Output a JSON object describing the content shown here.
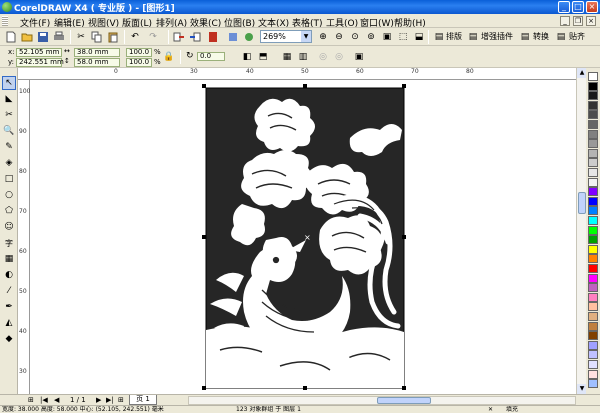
{
  "window": {
    "title": "CorelDRAW X4 ( 专业版 ) - [图形1]"
  },
  "menu": [
    "文件(F)",
    "编辑(E)",
    "视图(V)",
    "版面(L)",
    "排列(A)",
    "效果(C)",
    "位图(B)",
    "文本(X)",
    "表格(T)",
    "工具(O)",
    "窗口(W)",
    "帮助(H)"
  ],
  "toolbar": {
    "zoom_level": "269%",
    "buttons": {
      "layout": "排版",
      "plugins": "增强插件",
      "convert": "转换",
      "paste": "贴齐"
    }
  },
  "property_bar": {
    "x_label": "x:",
    "x_value": "52.105 mm",
    "y_label": "y:",
    "y_value": "242.551 mm",
    "width_value": "38.0 mm",
    "height_value": "58.0 mm",
    "scale_x": "100.0",
    "scale_y": "100.0",
    "percent": "%",
    "rotation": "0.0"
  },
  "ruler": {
    "h_labels": [
      "0",
      "30",
      "40",
      "50",
      "60",
      "70",
      "80"
    ],
    "v_labels": [
      "100",
      "90",
      "80",
      "70",
      "60",
      "50",
      "40",
      "30"
    ]
  },
  "palette_colors": [
    "#ffffff",
    "#000000",
    "#1a1a1a",
    "#333333",
    "#4d4d4d",
    "#666666",
    "#808080",
    "#999999",
    "#b3b3b3",
    "#cccccc",
    "#e6e6e6",
    "#f2f2f2",
    "#8000ff",
    "#0000ff",
    "#0080ff",
    "#00ffff",
    "#00ff00",
    "#00a000",
    "#ffff00",
    "#ff8000",
    "#ff0000",
    "#ff00ff",
    "#c060c0",
    "#ff80c0",
    "#ffc0a0",
    "#e0b080",
    "#c08040",
    "#804000",
    "#a0a0ff",
    "#c0c0ff",
    "#e0e0ff",
    "#ffe0e0",
    "#a0c0ff"
  ],
  "pagebar": {
    "page_info": "1 / 1",
    "page_tab": "页 1"
  },
  "statusbar": {
    "dims": "宽度: 38.000  高度: 58.000  中心: (52.105, 242.551)  毫米",
    "object": "123 对象群组 于 图层 1",
    "fill": "填充"
  },
  "icons": {
    "select": "pointer-icon",
    "zoom": "magnifier-icon",
    "text": "字"
  }
}
